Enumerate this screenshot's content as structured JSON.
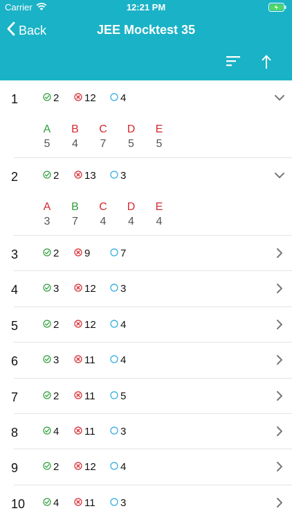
{
  "status": {
    "carrier": "Carrier",
    "time": "12:21 PM"
  },
  "nav": {
    "back_label": "Back",
    "title": "JEE Mocktest 35"
  },
  "colors": {
    "accent": "#1AB2C6",
    "correct": "#2E9E3A",
    "wrong": "#D7282F",
    "unattempted": "#29A9E0"
  },
  "questions": [
    {
      "number": "1",
      "correct": "2",
      "wrong": "12",
      "unattempted": "4",
      "expanded": true,
      "options": [
        {
          "letter": "A",
          "count": "5",
          "is_correct": true
        },
        {
          "letter": "B",
          "count": "4",
          "is_correct": false
        },
        {
          "letter": "C",
          "count": "7",
          "is_correct": false
        },
        {
          "letter": "D",
          "count": "5",
          "is_correct": false
        },
        {
          "letter": "E",
          "count": "5",
          "is_correct": false
        }
      ]
    },
    {
      "number": "2",
      "correct": "2",
      "wrong": "13",
      "unattempted": "3",
      "expanded": true,
      "options": [
        {
          "letter": "A",
          "count": "3",
          "is_correct": false
        },
        {
          "letter": "B",
          "count": "7",
          "is_correct": true
        },
        {
          "letter": "C",
          "count": "4",
          "is_correct": false
        },
        {
          "letter": "D",
          "count": "4",
          "is_correct": false
        },
        {
          "letter": "E",
          "count": "4",
          "is_correct": false
        }
      ]
    },
    {
      "number": "3",
      "correct": "2",
      "wrong": "9",
      "unattempted": "7",
      "expanded": false
    },
    {
      "number": "4",
      "correct": "3",
      "wrong": "12",
      "unattempted": "3",
      "expanded": false
    },
    {
      "number": "5",
      "correct": "2",
      "wrong": "12",
      "unattempted": "4",
      "expanded": false
    },
    {
      "number": "6",
      "correct": "3",
      "wrong": "11",
      "unattempted": "4",
      "expanded": false
    },
    {
      "number": "7",
      "correct": "2",
      "wrong": "11",
      "unattempted": "5",
      "expanded": false
    },
    {
      "number": "8",
      "correct": "4",
      "wrong": "11",
      "unattempted": "3",
      "expanded": false
    },
    {
      "number": "9",
      "correct": "2",
      "wrong": "12",
      "unattempted": "4",
      "expanded": false
    },
    {
      "number": "10",
      "correct": "4",
      "wrong": "11",
      "unattempted": "3",
      "expanded": false
    }
  ]
}
